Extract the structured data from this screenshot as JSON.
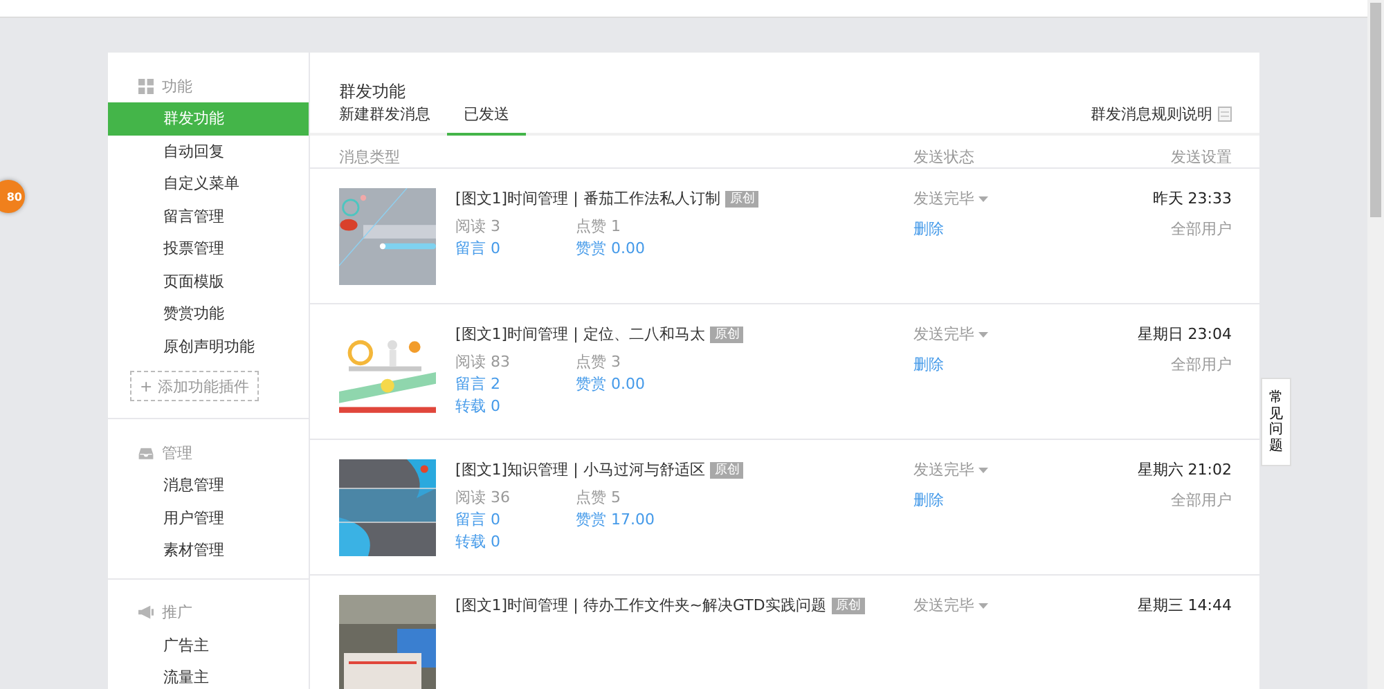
{
  "float_badge": {
    "text": "80"
  },
  "sidebar": {
    "groups": [
      {
        "title": "功能",
        "items": [
          {
            "label": "群发功能",
            "selected": true
          },
          {
            "label": "自动回复",
            "selected": false
          },
          {
            "label": "自定义菜单",
            "selected": false
          },
          {
            "label": "留言管理",
            "selected": false
          },
          {
            "label": "投票管理",
            "selected": false
          },
          {
            "label": "页面模版",
            "selected": false
          },
          {
            "label": "赞赏功能",
            "selected": false
          },
          {
            "label": "原创声明功能",
            "selected": false
          }
        ],
        "add_button": {
          "icon": "+",
          "label": "添加功能插件"
        }
      },
      {
        "title": "管理",
        "items": [
          {
            "label": "消息管理",
            "selected": false
          },
          {
            "label": "用户管理",
            "selected": false
          },
          {
            "label": "素材管理",
            "selected": false
          }
        ]
      },
      {
        "title": "推广",
        "items": [
          {
            "label": "广告主",
            "selected": false
          },
          {
            "label": "流量主",
            "selected": false
          }
        ]
      }
    ]
  },
  "main": {
    "title": "群发功能",
    "tabs": [
      {
        "label": "新建群发消息",
        "selected": false
      },
      {
        "label": "已发送",
        "selected": true
      }
    ],
    "rules_link": "群发消息规则说明",
    "table": {
      "columns": [
        "消息类型",
        "发送状态",
        "发送设置"
      ],
      "rows": [
        {
          "title": "[图文1]时间管理 | 番茄工作法私人订制",
          "badge": "原创",
          "stats": [
            {
              "kind": "count",
              "text": "阅读 3"
            },
            {
              "kind": "count",
              "text": "点赞 1"
            },
            {
              "kind": "link",
              "text": "留言 0"
            },
            {
              "kind": "link",
              "text": "赞赏 0.00"
            }
          ],
          "status": "发送完毕",
          "action": "删除",
          "time": "昨天 23:33",
          "audience": "全部用户"
        },
        {
          "title": "[图文1]时间管理 | 定位、二八和马太",
          "badge": "原创",
          "stats": [
            {
              "kind": "count",
              "text": "阅读 83"
            },
            {
              "kind": "count",
              "text": "点赞 3"
            },
            {
              "kind": "link",
              "text": "留言 2"
            },
            {
              "kind": "link",
              "text": "赞赏 0.00"
            },
            {
              "kind": "link",
              "text": "转载 0"
            }
          ],
          "status": "发送完毕",
          "action": "删除",
          "time": "星期日 23:04",
          "audience": "全部用户"
        },
        {
          "title": "[图文1]知识管理 | 小马过河与舒适区",
          "badge": "原创",
          "stats": [
            {
              "kind": "count",
              "text": "阅读 36"
            },
            {
              "kind": "count",
              "text": "点赞 5"
            },
            {
              "kind": "link",
              "text": "留言 0"
            },
            {
              "kind": "link",
              "text": "赞赏 17.00"
            },
            {
              "kind": "link",
              "text": "转载 0"
            }
          ],
          "status": "发送完毕",
          "action": "删除",
          "time": "星期六 21:02",
          "audience": "全部用户"
        },
        {
          "title": "[图文1]时间管理 | 待办工作文件夹~解决GTD实践问题",
          "badge": "原创",
          "status": "发送完毕",
          "time": "星期三 14:44"
        }
      ]
    }
  },
  "faq_tab": {
    "label": "常见问题"
  }
}
